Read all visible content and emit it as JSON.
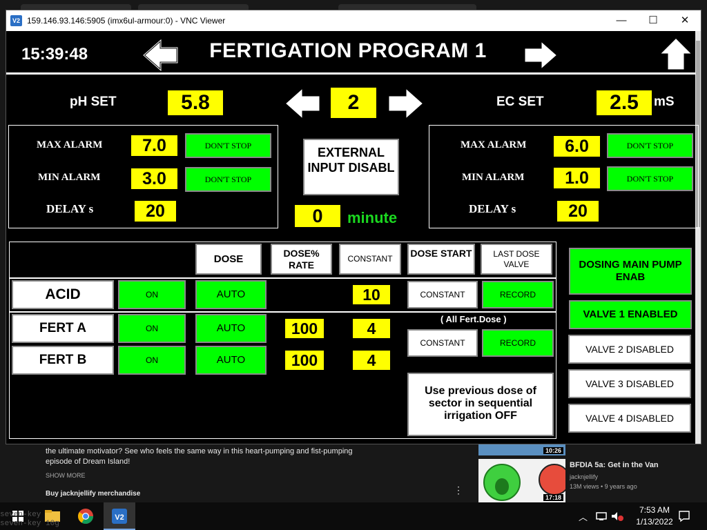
{
  "background": {
    "video_desc_line1": "the ultimate motivator? See who feels the same way in this heart-pumping and fist-pumping",
    "video_desc_line2": "episode of Dream Island!",
    "show_more": "SHOW MORE",
    "merch": "Buy jacknjellify merchandise",
    "thumb1_time": "10:26",
    "thumb2_time": "17:18",
    "rec_title": "BFDIA 5a: Get in the Van",
    "rec_channel": "jacknjellify",
    "rec_meta": "13M views • 9 years ago",
    "dots_icon": "more-vert-icon"
  },
  "window": {
    "title": "159.146.93.146:5905 (imx6ul-armour:0) - VNC Viewer",
    "icon_label": "V2",
    "minimize": "—",
    "maximize": "☐",
    "close": "✕"
  },
  "hmi": {
    "time": "15:39:48",
    "title": "FERTIGATION PROGRAM 1",
    "ph_set_label": "pH SET",
    "ph_set_value": "5.8",
    "program_number": "2",
    "ec_set_label": "EC SET",
    "ec_set_value": "2.5",
    "ec_unit": "mS",
    "left_alarm": {
      "max_label": "MAX ALARM",
      "max_value": "7.0",
      "max_action": "DON'T STOP",
      "min_label": "MIN ALARM",
      "min_value": "3.0",
      "min_action": "DON'T STOP",
      "delay_label": "DELAY s",
      "delay_value": "20"
    },
    "right_alarm": {
      "max_label": "MAX ALARM",
      "max_value": "6.0",
      "max_action": "DON'T STOP",
      "min_label": "MIN ALARM",
      "min_value": "1.0",
      "min_action": "DON'T STOP",
      "delay_label": "DELAY s",
      "delay_value": "20"
    },
    "external_input": "EXTERNAL INPUT DISABL",
    "minute_value": "0",
    "minute_label": "minute",
    "table": {
      "headers": {
        "dose": "DOSE",
        "dose_rate": "DOSE% RATE",
        "constant": "CONSTANT",
        "dose_start": "DOSE START",
        "last_dose_valve": "LAST DOSE VALVE"
      },
      "rows": [
        {
          "name": "ACID",
          "on": "ON",
          "mode": "AUTO",
          "rate": "",
          "constant": "10"
        },
        {
          "name": "FERT A",
          "on": "ON",
          "mode": "AUTO",
          "rate": "100",
          "constant": "4"
        },
        {
          "name": "FERT B",
          "on": "ON",
          "mode": "AUTO",
          "rate": "100",
          "constant": "4"
        }
      ],
      "acid_dose_start": "CONSTANT",
      "acid_last_dose": "RECORD",
      "all_fert_label": "( All Fert.Dose )",
      "fert_dose_start": "CONSTANT",
      "fert_last_dose": "RECORD",
      "previous_dose": "Use previous dose of sector in sequential irrigation OFF"
    },
    "pumps": {
      "main": "DOSING MAIN PUMP ENAB",
      "valve1": "VALVE 1 ENABLED",
      "valve2": "VALVE 2 DISABLED",
      "valve3": "VALVE 3 DISABLED",
      "valve4": "VALVE 4 DISABLED"
    }
  },
  "taskbar": {
    "time": "7:53 AM",
    "date": "1/13/2022",
    "ghost_text1": "seven-key 10g",
    "ghost_text2": "seven-key 10g"
  },
  "colors": {
    "yellow": "#ffff00",
    "green": "#00ff00",
    "white": "#ffffff",
    "black": "#000000",
    "green_text": "#1bd820"
  }
}
